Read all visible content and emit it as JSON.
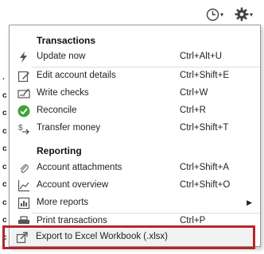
{
  "menu": {
    "sections": [
      {
        "header": "Transactions",
        "items": [
          {
            "label": "Update now",
            "shortcut": "Ctrl+Alt+U",
            "icon": "lightning-icon"
          },
          {
            "label": "Edit account details",
            "shortcut": "Ctrl+Shift+E",
            "icon": "edit-icon"
          },
          {
            "label": "Write checks",
            "shortcut": "Ctrl+W",
            "icon": "check-icon"
          },
          {
            "label": "Reconcile",
            "shortcut": "Ctrl+R",
            "icon": "reconcile-icon"
          },
          {
            "label": "Transfer money",
            "shortcut": "Ctrl+Shift+T",
            "icon": "transfer-icon"
          }
        ]
      },
      {
        "header": "Reporting",
        "items": [
          {
            "label": "Account attachments",
            "shortcut": "Ctrl+Shift+A",
            "icon": "paperclip-icon"
          },
          {
            "label": "Account overview",
            "shortcut": "Ctrl+Shift+O",
            "icon": "chart-icon"
          },
          {
            "label": "More reports",
            "shortcut": "",
            "icon": "reports-icon"
          },
          {
            "label": "Print transactions",
            "shortcut": "Ctrl+P",
            "icon": "printer-icon"
          }
        ]
      }
    ],
    "export": {
      "label": "Export to Excel Workbook (.xlsx)",
      "icon": "export-icon"
    }
  },
  "submenu_arrow": "▶",
  "caret": "▾",
  "left_strip_chars": [
    ".",
    "c",
    "c",
    "c",
    "c",
    "c",
    "c",
    "c",
    "c",
    "c",
    "c",
    "c"
  ]
}
